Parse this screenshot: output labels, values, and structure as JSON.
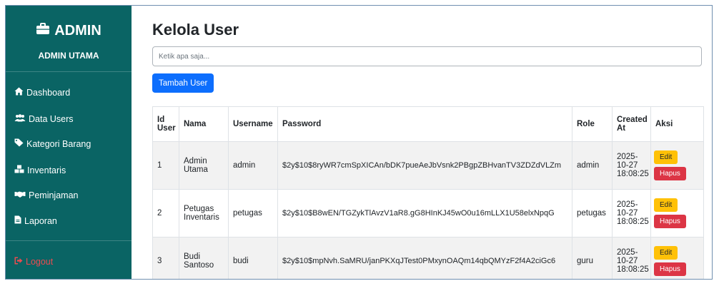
{
  "sidebar": {
    "brand": "ADMIN",
    "subtitle": "ADMIN UTAMA",
    "items": [
      {
        "label": "Dashboard",
        "icon": "home-icon"
      },
      {
        "label": "Data Users",
        "icon": "users-icon"
      },
      {
        "label": "Kategori Barang",
        "icon": "tag-icon"
      },
      {
        "label": "Inventaris",
        "icon": "boxes-icon"
      },
      {
        "label": "Peminjaman",
        "icon": "handshake-icon"
      },
      {
        "label": "Laporan",
        "icon": "file-icon"
      }
    ],
    "logout": "Logout"
  },
  "main": {
    "title": "Kelola User",
    "search_placeholder": "Ketik apa saja...",
    "add_button": "Tambah User",
    "table": {
      "headers": [
        "Id User",
        "Nama",
        "Username",
        "Password",
        "Role",
        "Created At",
        "Aksi"
      ],
      "rows": [
        {
          "id": "1",
          "nama": "Admin Utama",
          "username": "admin",
          "password": "$2y$10$8ryWR7cmSpXICAn/bDK7pueAeJbVsnk2PBgpZBHvanTV3ZDZdVLZm",
          "role": "admin",
          "created": "2025-10-27 18:08:25"
        },
        {
          "id": "2",
          "nama": "Petugas Inventaris",
          "username": "petugas",
          "password": "$2y$10$B8wEN/TGZykTlAvzV1aR8.gG8HInKJ45wO0u16mLLX1U58elxNpqG",
          "role": "petugas",
          "created": "2025-10-27 18:08:25"
        },
        {
          "id": "3",
          "nama": "Budi Santoso",
          "username": "budi",
          "password": "$2y$10$mpNvh.SaMRU/janPKXqJTest0PMxynOAQm14qbQMYzF2f4A2ciGc6",
          "role": "guru",
          "created": "2025-10-27 18:08:25"
        }
      ],
      "edit_label": "Edit",
      "delete_label": "Hapus"
    }
  },
  "colors": {
    "sidebar_bg": "#0a6464",
    "primary": "#0d6efd",
    "warning": "#ffc107",
    "danger": "#dc3545",
    "logout": "#ea4b50"
  }
}
